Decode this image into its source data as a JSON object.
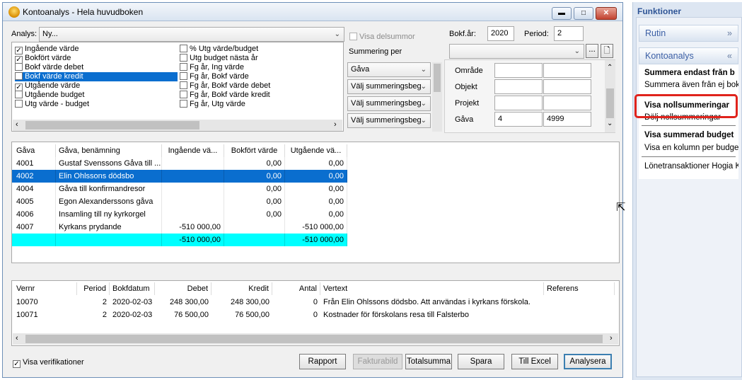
{
  "window": {
    "title": "Kontoanalys - Hela huvudboken",
    "min": "▬",
    "max": "□",
    "close": "✕"
  },
  "top": {
    "analys_label": "Analys:",
    "analys_value": "Ny...",
    "visa_delsummor": "Visa delsummor",
    "summering_per": "Summering per",
    "bokfar_label": "Bokf.år:",
    "bokfar_value": "2020",
    "period_label": "Period:",
    "period_value": "2"
  },
  "checklist_left": [
    {
      "label": "Ingående värde",
      "checked": true
    },
    {
      "label": "Bokfört värde",
      "checked": true
    },
    {
      "label": "Bokf värde debet",
      "checked": false
    },
    {
      "label": "Bokf värde kredit",
      "checked": false
    },
    {
      "label": "Utgående värde",
      "checked": true
    },
    {
      "label": "Utgående budget",
      "checked": false
    },
    {
      "label": "Utg värde - budget",
      "checked": false
    }
  ],
  "checklist_right": [
    {
      "label": "% Utg värde/budget",
      "checked": false
    },
    {
      "label": "Utg budget nästa år",
      "checked": false
    },
    {
      "label": "Fg år, Ing värde",
      "checked": false
    },
    {
      "label": "Fg år, Bokf värde",
      "checked": false
    },
    {
      "label": "Fg år, Bokf värde debet",
      "checked": false
    },
    {
      "label": "Fg år, Bokf värde kredit",
      "checked": false
    },
    {
      "label": "Fg år, Utg värde",
      "checked": false
    }
  ],
  "summering": [
    "Gåva",
    "Välj summeringsbeg",
    "Välj summeringsbeg",
    "Välj summeringsbeg"
  ],
  "filters": [
    {
      "label": "Område",
      "from": "",
      "to": ""
    },
    {
      "label": "Objekt",
      "from": "",
      "to": ""
    },
    {
      "label": "Projekt",
      "from": "",
      "to": ""
    },
    {
      "label": "Gåva",
      "from": "4",
      "to": "4999"
    }
  ],
  "dots": "...",
  "grid": {
    "headers": [
      "Gåva",
      "Gåva, benämning",
      "Ingående vä...",
      "Bokfört värde",
      "Utgående vä..."
    ],
    "rows": [
      [
        "4001",
        "Gustaf Svenssons Gåva till ...",
        "",
        "0,00",
        "0,00"
      ],
      [
        "4002",
        "Elin Ohlssons dödsbo",
        "",
        "0,00",
        "0,00"
      ],
      [
        "4004",
        "Gåva till konfirmandresor",
        "",
        "0,00",
        "0,00"
      ],
      [
        "4005",
        "Egon Alexanderssons gåva",
        "",
        "0,00",
        "0,00"
      ],
      [
        "4006",
        "Insamling till ny kyrkorgel",
        "",
        "0,00",
        "0,00"
      ],
      [
        "4007",
        "Kyrkans prydande",
        "-510 000,00",
        "",
        "-510 000,00"
      ],
      [
        "",
        "",
        "-510 000,00",
        "",
        "-510 000,00"
      ]
    ]
  },
  "ver": {
    "headers": [
      "Vernr",
      "Period",
      "Bokfdatum",
      "Debet",
      "Kredit",
      "Antal",
      "Vertext",
      "Referens"
    ],
    "rows": [
      [
        "10070",
        "2",
        "2020-02-03",
        "248 300,00",
        "248 300,00",
        "0",
        "Från Elin Ohlssons dödsbo. Att användas i kyrkans förskola.",
        ""
      ],
      [
        "10071",
        "2",
        "2020-02-03",
        "76 500,00",
        "76 500,00",
        "0",
        "Kostnader för förskolans resa till Falsterbo",
        ""
      ]
    ]
  },
  "bottom": {
    "visa_verifikationer": "Visa verifikationer",
    "buttons": [
      "Rapport",
      "Fakturabild",
      "Totalsumma",
      "Spara",
      "Till Excel",
      "Analysera"
    ]
  },
  "side": {
    "title": "Funktioner",
    "rutin": "Rutin",
    "kontoanalys": "Kontoanalys",
    "items": [
      "Summera endast från b",
      "Summera även från ej bokf",
      "Visa nollsummeringar",
      "Dölj nollsummeringar",
      "Visa summerad budget",
      "Visa en kolumn per budget",
      "Lönetransaktioner Hogia Ky"
    ]
  }
}
